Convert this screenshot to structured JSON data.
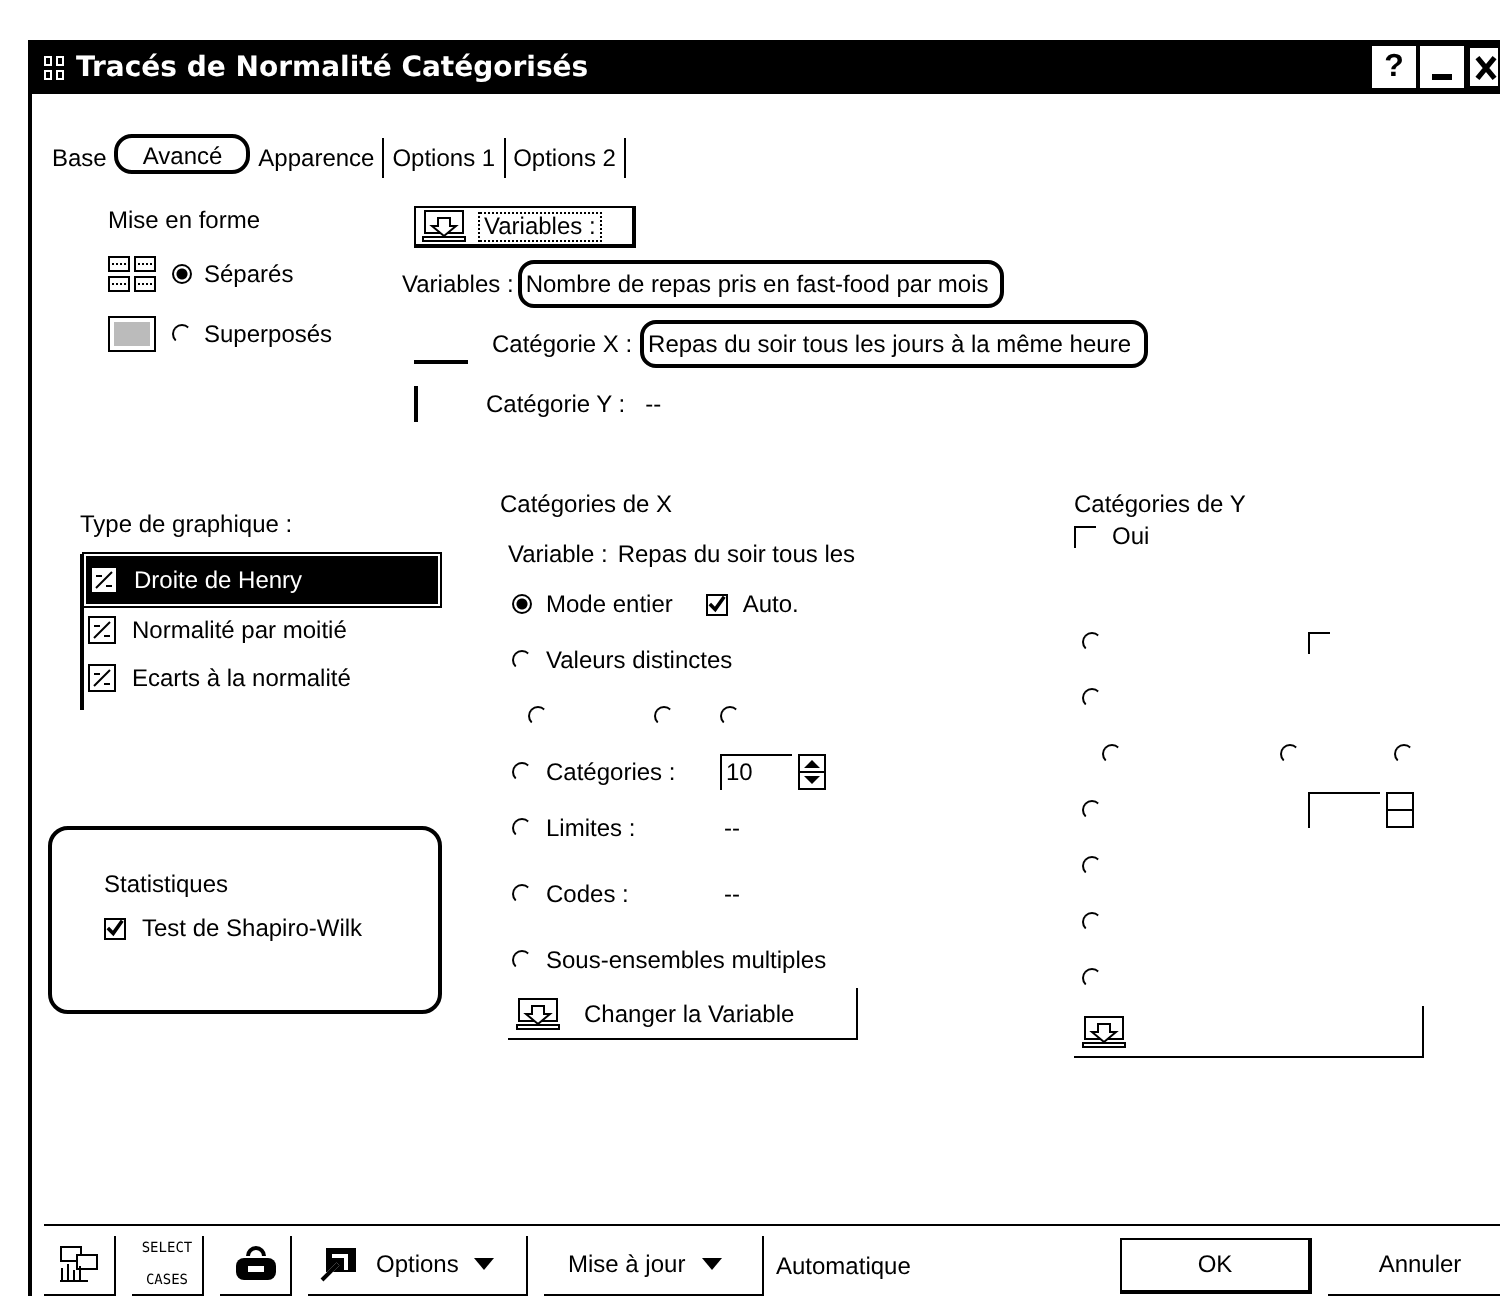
{
  "window": {
    "title": "Tracés de Normalité Catégorisés",
    "help": "?"
  },
  "tabs": [
    {
      "label": "Base",
      "selected": false
    },
    {
      "label": "Avancé",
      "selected": true
    },
    {
      "label": "Apparence",
      "selected": false
    },
    {
      "label": "Options 1",
      "selected": false
    },
    {
      "label": "Options 2",
      "selected": false
    }
  ],
  "layout": {
    "label": "Mise en forme",
    "options": [
      {
        "label": "Séparés",
        "kind": "separate",
        "selected": true
      },
      {
        "label": "Superposés",
        "kind": "overlay",
        "selected": false
      }
    ]
  },
  "variables_button": "Variables :",
  "variables": {
    "label": "Variables :",
    "value": "Nombre de repas pris en fast-food par mois"
  },
  "category_x": {
    "label": "Catégorie X :",
    "value": "Repas du soir tous les jours à la même heure"
  },
  "category_y": {
    "label": "Catégorie Y :",
    "value": "--"
  },
  "chart_type": {
    "label": "Type de graphique :",
    "items": [
      {
        "label": "Droite de Henry",
        "selected": true
      },
      {
        "label": "Normalité par moitié",
        "selected": false
      },
      {
        "label": "Ecarts à la normalité",
        "selected": false
      }
    ]
  },
  "statistics": {
    "label": "Statistiques",
    "checkbox": {
      "label": "Test de Shapiro-Wilk",
      "checked": true
    }
  },
  "x_categories": {
    "title": "Catégories de X",
    "variable_label": "Variable :",
    "variable": "Repas du soir tous les",
    "options": [
      {
        "kind": "radio",
        "label": "Mode entier",
        "selected": true,
        "checkbox": {
          "label": "Auto.",
          "checked": true
        }
      },
      {
        "kind": "radio",
        "label": "Valeurs distinctes",
        "selected": false
      },
      {
        "kind": "radios",
        "items": [
          {
            "selected": false
          },
          {
            "selected": false
          },
          {
            "selected": false
          }
        ]
      },
      {
        "kind": "spin",
        "label": "Catégories :",
        "selected": false,
        "number": "10"
      },
      {
        "kind": "radio",
        "label": "Limites :",
        "selected": false,
        "value": "--"
      },
      {
        "kind": "radio",
        "label": "Codes :",
        "selected": false,
        "value": "--"
      },
      {
        "kind": "radio",
        "label": "Sous-ensembles multiples",
        "selected": false
      }
    ],
    "button": "Changer la Variable"
  },
  "y_categories": {
    "title": "Catégories de Y",
    "checkbox": {
      "label": "Oui",
      "checked": false
    },
    "options": [
      {
        "kind": "radio",
        "selected": false,
        "checkbox": {
          "checked": false
        }
      },
      {
        "kind": "radio",
        "selected": false
      },
      {
        "kind": "radios",
        "items": [
          {
            "selected": false
          },
          {
            "selected": false
          },
          {
            "selected": false
          }
        ]
      },
      {
        "kind": "spin",
        "selected": false
      },
      {
        "kind": "radio",
        "selected": false
      },
      {
        "kind": "radio",
        "selected": false
      },
      {
        "kind": "radio",
        "selected": false
      }
    ]
  },
  "footer": {
    "select_cases": [
      "SELECT",
      "CASES"
    ],
    "options": "Options",
    "update": "Mise à jour",
    "mode": "Automatique",
    "ok": "OK",
    "cancel": "Annuler"
  }
}
